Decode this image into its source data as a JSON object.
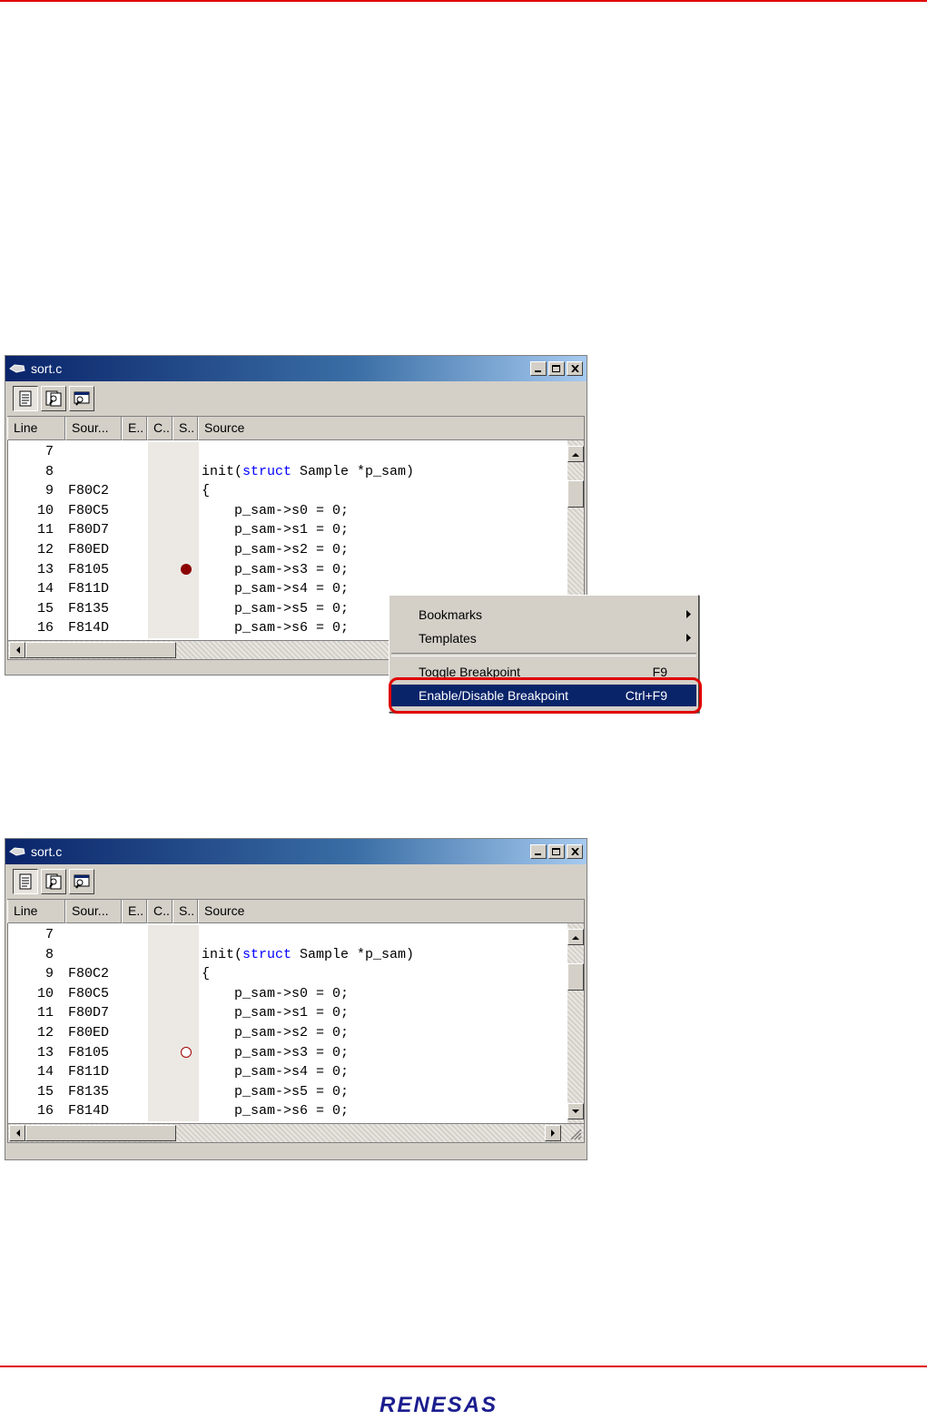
{
  "windows": [
    {
      "title": "sort.c",
      "columns": [
        "Line",
        "Sour...",
        "E..",
        "C..",
        "S..",
        "Source"
      ],
      "breakpoint_state": "enabled"
    },
    {
      "title": "sort.c",
      "columns": [
        "Line",
        "Sour...",
        "E..",
        "C..",
        "S..",
        "Source"
      ],
      "breakpoint_state": "disabled"
    }
  ],
  "rows": [
    {
      "line": "7",
      "addr": "",
      "code": ""
    },
    {
      "line": "8",
      "addr": "",
      "code_pre": "init(",
      "code_kw": "struct",
      "code_post": " Sample *p_sam)"
    },
    {
      "line": "9",
      "addr": "F80C2",
      "code": "{"
    },
    {
      "line": "10",
      "addr": "F80C5",
      "code": "    p_sam->s0 = 0;"
    },
    {
      "line": "11",
      "addr": "F80D7",
      "code": "    p_sam->s1 = 0;"
    },
    {
      "line": "12",
      "addr": "F80ED",
      "code": "    p_sam->s2 = 0;"
    },
    {
      "line": "13",
      "addr": "F8105",
      "code": "    p_sam->s3 = 0;"
    },
    {
      "line": "14",
      "addr": "F811D",
      "code": "    p_sam->s4 = 0;"
    },
    {
      "line": "15",
      "addr": "F8135",
      "code": "    p_sam->s5 = 0;"
    },
    {
      "line": "16",
      "addr": "F814D",
      "code": "    p_sam->s6 = 0;"
    }
  ],
  "context_menu": {
    "bookmarks": "Bookmarks",
    "templates": "Templates",
    "toggle_breakpoint": "Toggle Breakpoint",
    "toggle_shortcut": "F9",
    "enable_disable_breakpoint": "Enable/Disable Breakpoint",
    "enable_shortcut": "Ctrl+F9"
  },
  "logo_text": "RENESAS",
  "colors": {
    "accent_red": "#e00000",
    "title_blue": "#0a246a",
    "breakpoint": "#8b0000",
    "keyword": "#0000ff"
  }
}
